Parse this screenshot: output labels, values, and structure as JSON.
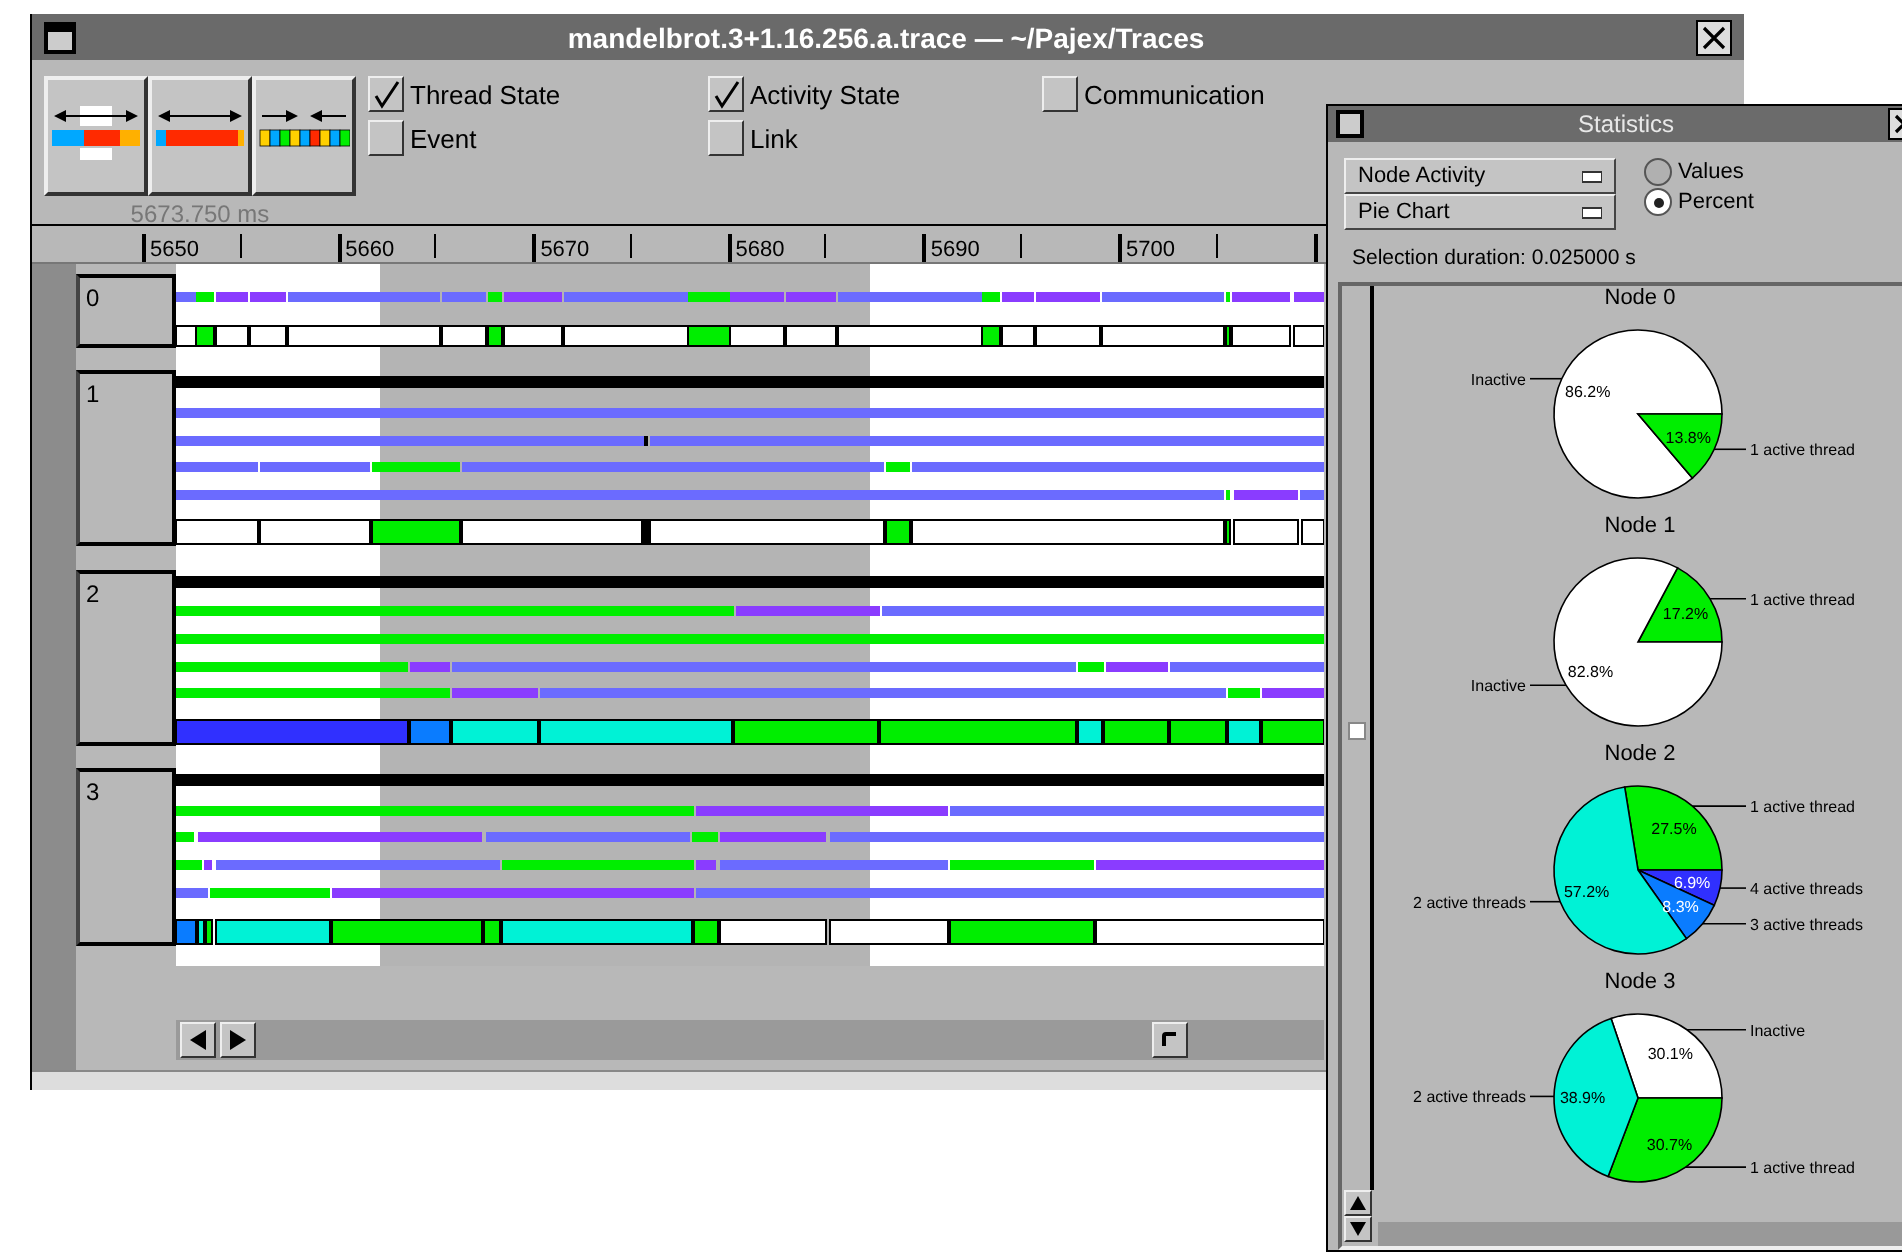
{
  "main_window": {
    "title": "mandelbrot.3+1.16.256.a.trace — ~/Pajex/Traces",
    "time_readout": "5673.750 ms",
    "checkboxes": [
      {
        "label": "Thread State",
        "checked": true
      },
      {
        "label": "Activity State",
        "checked": true
      },
      {
        "label": "Communication",
        "checked": false
      },
      {
        "label": "Event",
        "checked": false
      },
      {
        "label": "Link",
        "checked": false
      }
    ],
    "ruler": {
      "ticks": [
        "5650",
        "5660",
        "5670",
        "5680",
        "5690",
        "5700"
      ]
    },
    "nodes": [
      {
        "label": "0"
      },
      {
        "label": "1"
      },
      {
        "label": "2"
      },
      {
        "label": "3"
      }
    ]
  },
  "statistics_window": {
    "title": "Statistics",
    "dropdowns": [
      {
        "value": "Node Activity"
      },
      {
        "value": "Pie Chart"
      }
    ],
    "radios": [
      {
        "label": "Values",
        "selected": false
      },
      {
        "label": "Percent",
        "selected": true
      }
    ],
    "selection_duration": "Selection duration: 0.025000 s",
    "charts": [
      {
        "chart_data": {
          "type": "pie",
          "title": "Node 0",
          "categories": [
            "Inactive",
            "1 active thread"
          ],
          "values": [
            86.2,
            13.8
          ],
          "colors": [
            "#ffffff",
            "#00ee00"
          ],
          "value_labels": [
            "86.2%",
            "13.8%"
          ]
        }
      },
      {
        "chart_data": {
          "type": "pie",
          "title": "Node 1",
          "categories": [
            "1 active thread",
            "Inactive"
          ],
          "values": [
            17.2,
            82.8
          ],
          "colors": [
            "#00ee00",
            "#ffffff"
          ],
          "value_labels": [
            "17.2%",
            "82.8%"
          ]
        }
      },
      {
        "chart_data": {
          "type": "pie",
          "title": "Node 2",
          "categories": [
            "1 active thread",
            "4 active threads",
            "3 active threads",
            "2 active threads"
          ],
          "values": [
            27.5,
            6.9,
            8.3,
            57.2
          ],
          "colors": [
            "#00ee00",
            "#3030ff",
            "#0a7cff",
            "#00f2d6"
          ],
          "value_labels": [
            "27.5%",
            "6.9%",
            "8.3%",
            "57.2%"
          ]
        }
      },
      {
        "chart_data": {
          "type": "pie",
          "title": "Node 3",
          "categories": [
            "Inactive",
            "1 active thread",
            "2 active threads"
          ],
          "values": [
            30.1,
            30.7,
            38.9
          ],
          "colors": [
            "#ffffff",
            "#00ee00",
            "#00f2d6"
          ],
          "value_labels": [
            "30.1%",
            "30.7%",
            "38.9%"
          ]
        }
      }
    ]
  }
}
